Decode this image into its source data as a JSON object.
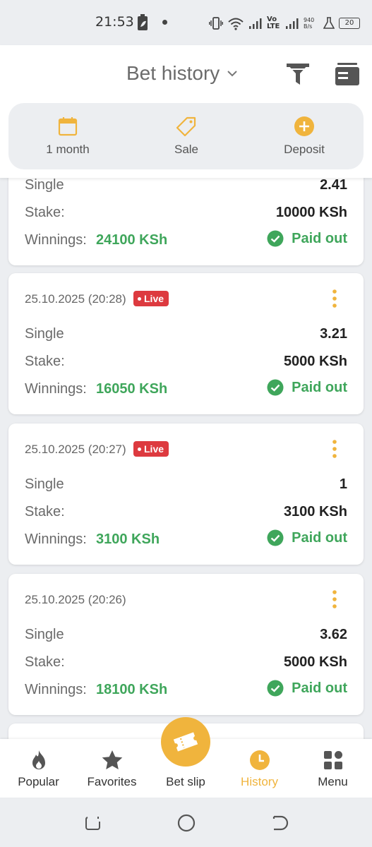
{
  "status_bar": {
    "time": "21:53",
    "net_speed_value": "940",
    "net_speed_unit": "B/s",
    "volte_top": "Vo",
    "volte_bottom": "LTE",
    "battery": "20"
  },
  "header": {
    "title": "Bet history",
    "quick_filters": [
      {
        "label": "1 month",
        "icon": "calendar-icon"
      },
      {
        "label": "Sale",
        "icon": "tag-icon"
      },
      {
        "label": "Deposit",
        "icon": "plus-circle-icon"
      }
    ]
  },
  "labels": {
    "type_single": "Single",
    "stake": "Stake:",
    "winnings": "Winnings:",
    "paid_out": "Paid out",
    "live": "Live"
  },
  "bets": [
    {
      "date": "",
      "live": false,
      "type": "Single",
      "odds": "2.41",
      "stake": "10000 KSh",
      "winnings": "24100 KSh",
      "status": "Paid out"
    },
    {
      "date": "25.10.2025 (20:28)",
      "live": true,
      "type": "Single",
      "odds": "3.21",
      "stake": "5000 KSh",
      "winnings": "16050 KSh",
      "status": "Paid out"
    },
    {
      "date": "25.10.2025 (20:27)",
      "live": true,
      "type": "Single",
      "odds": "1",
      "stake": "3100 KSh",
      "winnings": "3100 KSh",
      "status": "Paid out"
    },
    {
      "date": "25.10.2025 (20:26)",
      "live": false,
      "type": "Single",
      "odds": "3.62",
      "stake": "5000 KSh",
      "winnings": "18100 KSh",
      "status": "Paid out"
    }
  ],
  "bottom_nav": {
    "items": [
      {
        "label": "Popular",
        "icon": "flame-icon"
      },
      {
        "label": "Favorites",
        "icon": "star-icon"
      },
      {
        "label": "Bet slip",
        "icon": "ticket-icon"
      },
      {
        "label": "History",
        "icon": "clock-icon",
        "active": true
      },
      {
        "label": "Menu",
        "icon": "grid-icon"
      }
    ]
  },
  "colors": {
    "accent": "#f0b43d",
    "success": "#3fa65b",
    "live": "#dd3a3f",
    "background": "#eceef1"
  }
}
